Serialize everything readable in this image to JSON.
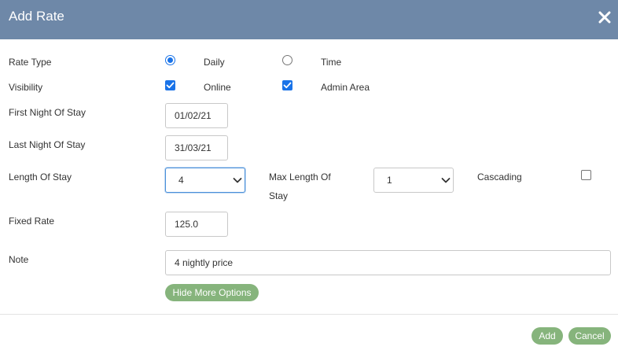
{
  "dialog": {
    "title": "Add Rate",
    "close_icon": "close-icon"
  },
  "form": {
    "rate_type": {
      "label": "Rate Type",
      "options": [
        {
          "label": "Daily",
          "selected": true
        },
        {
          "label": "Time",
          "selected": false
        }
      ]
    },
    "visibility": {
      "label": "Visibility",
      "options": [
        {
          "label": "Online",
          "checked": true
        },
        {
          "label": "Admin Area",
          "checked": true
        }
      ]
    },
    "first_night": {
      "label": "First Night Of Stay",
      "value": "01/02/21"
    },
    "last_night": {
      "label": "Last Night Of Stay",
      "value": "31/03/21"
    },
    "length_of_stay": {
      "label": "Length Of Stay",
      "value": "4"
    },
    "max_length_of_stay": {
      "label_line1": "Max Length Of",
      "label_line2": "Stay",
      "value": "1"
    },
    "cascading": {
      "label": "Cascading",
      "checked": false
    },
    "fixed_rate": {
      "label": "Fixed Rate",
      "value": "125.0"
    },
    "note": {
      "label": "Note",
      "value": "4 nightly price"
    },
    "more_options_label": "Hide More Options"
  },
  "footer": {
    "add_label": "Add",
    "cancel_label": "Cancel"
  },
  "colors": {
    "header": "#6e88a8",
    "accent_green": "#86b47c",
    "check_blue": "#1a73e8"
  }
}
